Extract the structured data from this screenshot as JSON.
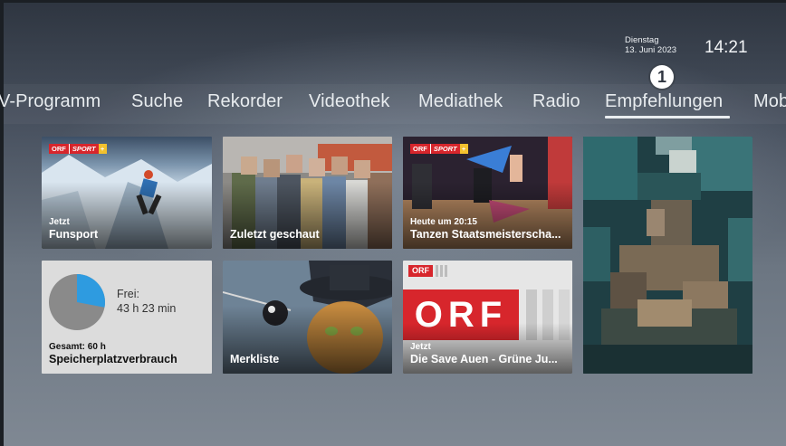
{
  "header": {
    "weekday": "Dienstag",
    "date": "13. Juni 2023",
    "time": "14:21",
    "badge": "1"
  },
  "nav": {
    "items": [
      "V-Programm",
      "Suche",
      "Rekorder",
      "Videothek",
      "Mediathek",
      "Radio",
      "Empfehlungen",
      "Mob"
    ],
    "active": "Empfehlungen"
  },
  "tiles": {
    "funsport": {
      "logo": "ORF",
      "logo_sub": "SPORT",
      "label": "Jetzt",
      "title": "Funsport"
    },
    "zuletzt": {
      "title": "Zuletzt geschaut"
    },
    "tanzen": {
      "logo": "ORF",
      "logo_sub": "SPORT",
      "label": "Heute um 20:15",
      "title": "Tanzen Staatsmeisterscha..."
    },
    "speicher": {
      "free_label": "Frei:",
      "free_value": "43 h 23 min",
      "total": "Gesamt: 60 h",
      "title": "Speicherplatzverbrauch",
      "used_fraction": 0.28
    },
    "merkliste": {
      "title": "Merkliste"
    },
    "orf3": {
      "logo_small": "ORF",
      "logo_big": "ORF",
      "label": "Jetzt",
      "title": "Die Save Auen - Grüne Ju..."
    }
  },
  "colors": {
    "accent_red": "#d7262c",
    "storage_used": "#2e9be0",
    "storage_free": "#8a8a8a"
  }
}
